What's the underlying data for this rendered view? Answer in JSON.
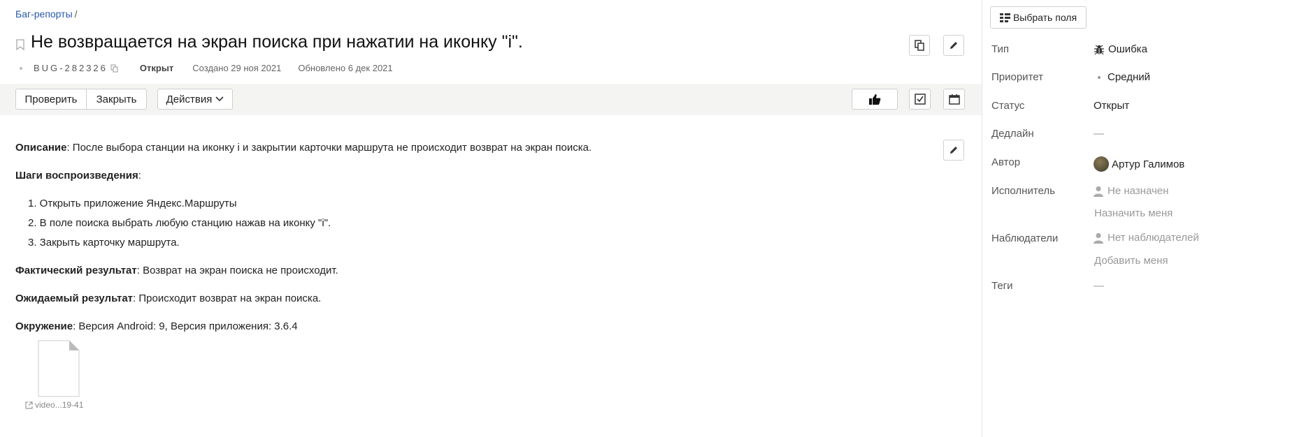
{
  "breadcrumb": {
    "link": "Баг-репорты",
    "separator": "/"
  },
  "issue": {
    "title": "Не возвращается на экран поиска при нажатии на иконку \"i\".",
    "key": "BUG-282326",
    "status": "Открыт",
    "created": "Создано 29 ноя 2021",
    "updated": "Обновлено 6 дек 2021"
  },
  "toolbar": {
    "check_label": "Проверить",
    "close_label": "Закрыть",
    "actions_label": "Действия"
  },
  "description": {
    "description_label": "Описание",
    "description_text": ": После выбора станции на иконку i и закрытии карточки маршрута не происходит возврат на экран поиска.",
    "steps_label": "Шаги воспроизведения",
    "steps_suffix": ":",
    "steps": [
      "1. Открыть приложение Яндекс.Маршруты",
      "2. В поле поиска выбрать любую станцию нажав на иконку \"i\".",
      "3. Закрыть карточку маршрута."
    ],
    "actual_label": "Фактический результат",
    "actual_text": ": Возврат на экран поиска не происходит.",
    "expected_label": "Ожидаемый результат",
    "expected_text": ": Происходит возврат на экран поиска.",
    "env_label": "Окружение",
    "env_text": ": Версия Android: 9, Версия приложения: 3.6.4"
  },
  "attachment": {
    "name": "video...19-41"
  },
  "sidebar": {
    "choose_fields_label": "Выбрать поля",
    "fields": {
      "type_label": "Тип",
      "type_value": "Ошибка",
      "priority_label": "Приоритет",
      "priority_value": "Средний",
      "status_label": "Статус",
      "status_value": "Открыт",
      "deadline_label": "Дедлайн",
      "deadline_value": "—",
      "author_label": "Автор",
      "author_value": "Артур Галимов",
      "assignee_label": "Исполнитель",
      "assignee_value": "Не назначен",
      "assign_me": "Назначить меня",
      "watchers_label": "Наблюдатели",
      "watchers_value": "Нет наблюдателей",
      "add_me": "Добавить меня",
      "tags_label": "Теги",
      "tags_value": "—"
    }
  },
  "colors": {
    "link": "#2a58ad",
    "toolbar_bg": "#f4f4f2",
    "border": "#cfcfcf"
  }
}
